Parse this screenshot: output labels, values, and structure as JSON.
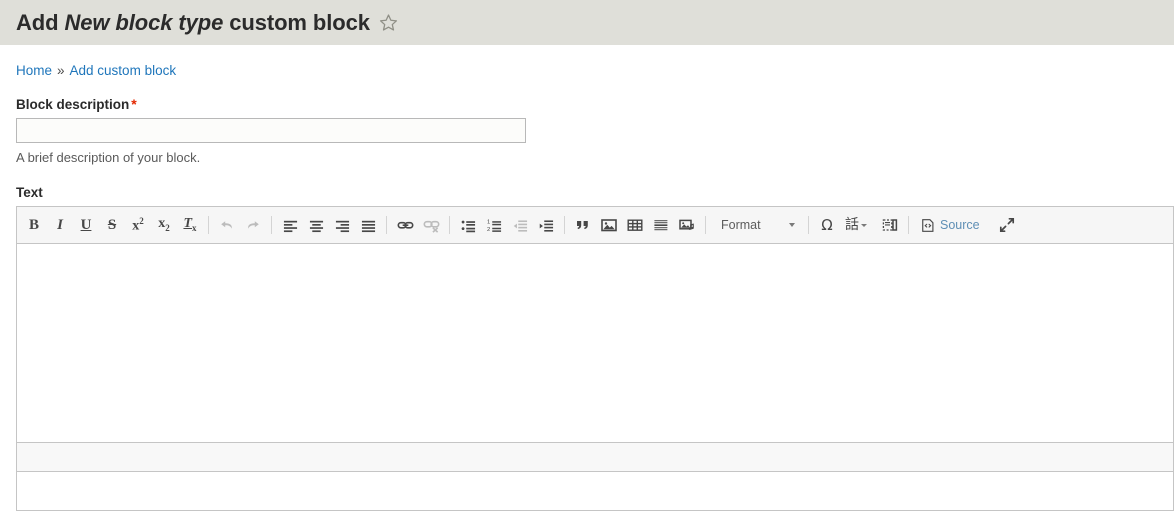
{
  "header": {
    "title_prefix": "Add",
    "title_emphasis": "New block type",
    "title_suffix": "custom block",
    "star_icon": "star-outline-icon",
    "background": "#dfdfd9"
  },
  "breadcrumb": {
    "items": [
      {
        "label": "Home",
        "link": true
      },
      {
        "label": "Add custom block",
        "link": true
      }
    ],
    "separator": "»",
    "link_color": "#1f76bb"
  },
  "form": {
    "block_description": {
      "label": "Block description",
      "required_marker": "*",
      "required_color": "#e32700",
      "value": "",
      "placeholder": "",
      "description": "A brief description of your block."
    },
    "text": {
      "label": "Text",
      "body_value": ""
    }
  },
  "editor": {
    "toolbar_groups": [
      {
        "name": "basic-styles",
        "buttons": [
          {
            "name": "bold-icon",
            "label": "B",
            "disabled": false
          },
          {
            "name": "italic-icon",
            "label": "I",
            "disabled": false
          },
          {
            "name": "underline-icon",
            "label": "U",
            "disabled": false
          },
          {
            "name": "strikethrough-icon",
            "label": "S",
            "disabled": false
          },
          {
            "name": "superscript-icon",
            "label": "x²",
            "disabled": false
          },
          {
            "name": "subscript-icon",
            "label": "x₂",
            "disabled": false
          },
          {
            "name": "remove-format-icon",
            "label": "Tx",
            "disabled": false
          }
        ]
      },
      {
        "name": "undo-redo",
        "buttons": [
          {
            "name": "undo-icon",
            "label": "Undo",
            "disabled": true
          },
          {
            "name": "redo-icon",
            "label": "Redo",
            "disabled": true
          }
        ]
      },
      {
        "name": "alignment",
        "buttons": [
          {
            "name": "align-left-icon",
            "label": "Align left",
            "disabled": false
          },
          {
            "name": "align-center-icon",
            "label": "Align center",
            "disabled": false
          },
          {
            "name": "align-right-icon",
            "label": "Align right",
            "disabled": false
          },
          {
            "name": "align-justify-icon",
            "label": "Justify",
            "disabled": false
          }
        ]
      },
      {
        "name": "links",
        "buttons": [
          {
            "name": "link-icon",
            "label": "Link",
            "disabled": false
          },
          {
            "name": "unlink-icon",
            "label": "Unlink",
            "disabled": true
          }
        ]
      },
      {
        "name": "lists-indent",
        "buttons": [
          {
            "name": "bulleted-list-icon",
            "label": "Bulleted list",
            "disabled": false
          },
          {
            "name": "numbered-list-icon",
            "label": "Numbered list",
            "disabled": false
          },
          {
            "name": "outdent-icon",
            "label": "Outdent",
            "disabled": true
          },
          {
            "name": "indent-icon",
            "label": "Indent",
            "disabled": false
          }
        ]
      },
      {
        "name": "insert",
        "buttons": [
          {
            "name": "blockquote-icon",
            "label": "Blockquote",
            "disabled": false
          },
          {
            "name": "image-icon",
            "label": "Image",
            "disabled": false
          },
          {
            "name": "table-icon",
            "label": "Table",
            "disabled": false
          },
          {
            "name": "horizontal-rule-icon",
            "label": "Horizontal rule",
            "disabled": false
          },
          {
            "name": "media-embed-icon",
            "label": "Media",
            "disabled": false
          }
        ]
      }
    ],
    "format_select": {
      "label": "Format",
      "caret_icon": "chevron-down-icon"
    },
    "tools": [
      {
        "name": "special-character-icon",
        "label": "Ω",
        "disabled": false
      },
      {
        "name": "language-icon",
        "label": "話",
        "disabled": false,
        "has_caret": true
      },
      {
        "name": "show-blocks-icon",
        "label": "Show blocks",
        "disabled": false
      }
    ],
    "source_button": {
      "label": "Source",
      "icon": "source-code-icon",
      "color": "#5f8fb5"
    },
    "maximize_button": {
      "name": "maximize-icon",
      "label": "Maximize"
    },
    "toolbar_background": "#f6f6f6",
    "border_color": "#c5c5c5"
  }
}
